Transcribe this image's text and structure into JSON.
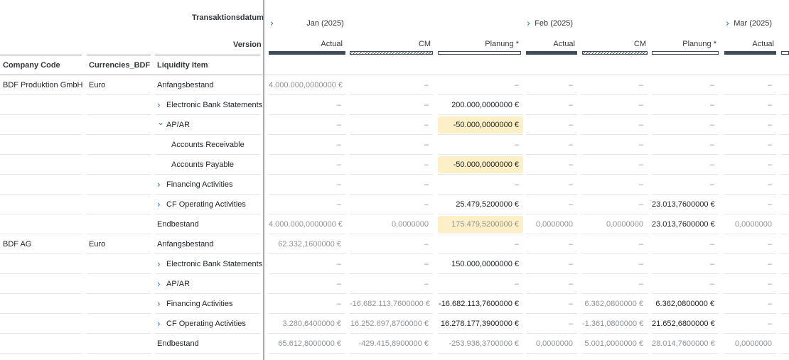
{
  "header": {
    "dimension_label": "Transaktionsdatum",
    "version_label": "Version",
    "months": [
      {
        "label": "Jan (2025)"
      },
      {
        "label": "Feb (2025)"
      },
      {
        "label": "Mar (2025)"
      }
    ],
    "versions": [
      "Actual",
      "CM",
      "Planung *",
      "Actual",
      "CM",
      "Planung *",
      "Actual"
    ]
  },
  "columns": {
    "company_code": "Company Code",
    "currencies": "Currencies_BDF",
    "liquidity_item": "Liquidity Item"
  },
  "colors": {
    "highlight": "#fdf0c6",
    "accent": "#2d6ca2",
    "bar": "#3e4a57"
  },
  "rows": [
    {
      "company": "BDF Produktion GmbH",
      "currency": "Euro",
      "item": "Anfangsbestand",
      "expand": "",
      "values": [
        "4.000.000,0000000 €",
        "–",
        "–",
        "–",
        "–",
        "–",
        "–"
      ]
    },
    {
      "company": "",
      "currency": "",
      "item": "Electronic Bank Statements",
      "expand": ">",
      "values": [
        "–",
        "–",
        "200.000,0000000 €",
        "–",
        "–",
        "–",
        "–"
      ]
    },
    {
      "company": "",
      "currency": "",
      "item": "AP/AR",
      "expand": "v",
      "values": [
        "–",
        "–",
        "-50.000,0000000 €",
        "–",
        "–",
        "–",
        "–"
      ]
    },
    {
      "company": "",
      "currency": "",
      "item": "Accounts Receivable",
      "expand": "child",
      "values": [
        "–",
        "–",
        "–",
        "–",
        "–",
        "–",
        "–"
      ]
    },
    {
      "company": "",
      "currency": "",
      "item": "Accounts Payable",
      "expand": "child",
      "values": [
        "–",
        "–",
        "-50.000,0000000 €",
        "–",
        "–",
        "–",
        "–"
      ]
    },
    {
      "company": "",
      "currency": "",
      "item": "Financing Activities",
      "expand": ">",
      "values": [
        "–",
        "–",
        "–",
        "–",
        "–",
        "–",
        "–"
      ]
    },
    {
      "company": "",
      "currency": "",
      "item": "CF Operating Activities",
      "expand": ">",
      "values": [
        "–",
        "–",
        "25.479,5200000 €",
        "–",
        "–",
        "23.013,7600000 €",
        "–"
      ]
    },
    {
      "company": "",
      "currency": "",
      "item": "Endbestand",
      "expand": "",
      "values": [
        "4.000.000,0000000 €",
        "0,0000000",
        "175.479,5200000 €",
        "0,0000000",
        "0,0000000",
        "23.013,7600000 €",
        "0,0000000"
      ]
    },
    {
      "company": "BDF AG",
      "currency": "Euro",
      "item": "Anfangsbestand",
      "expand": "",
      "values": [
        "62.332,1600000 €",
        "–",
        "–",
        "–",
        "–",
        "–",
        "–"
      ]
    },
    {
      "company": "",
      "currency": "",
      "item": "Electronic Bank Statements",
      "expand": ">",
      "values": [
        "–",
        "–",
        "150.000,0000000 €",
        "–",
        "–",
        "–",
        "–"
      ]
    },
    {
      "company": "",
      "currency": "",
      "item": "AP/AR",
      "expand": ">",
      "values": [
        "–",
        "–",
        "–",
        "–",
        "–",
        "–",
        "–"
      ]
    },
    {
      "company": "",
      "currency": "",
      "item": "Financing Activities",
      "expand": ">",
      "values": [
        "–",
        "-16.682.113,7600000 €",
        "-16.682.113,7600000 €",
        "–",
        "6.362,0800000 €",
        "6.362,0800000 €",
        "–"
      ]
    },
    {
      "company": "",
      "currency": "",
      "item": "CF Operating Activities",
      "expand": ">",
      "values": [
        "3.280,6400000 €",
        "16.252.697,8700000 €",
        "16.278.177,3900000 €",
        "–",
        "-1.361,0800000 €",
        "21.652,6800000 €",
        "–"
      ]
    },
    {
      "company": "",
      "currency": "",
      "item": "Endbestand",
      "expand": "",
      "values": [
        "65.612,8000000 €",
        "-429.415,8900000 €",
        "-253.936,3700000 €",
        "0,0000000",
        "5.001,0000000 €",
        "28.014,7600000 €",
        "0,0000000"
      ]
    }
  ]
}
